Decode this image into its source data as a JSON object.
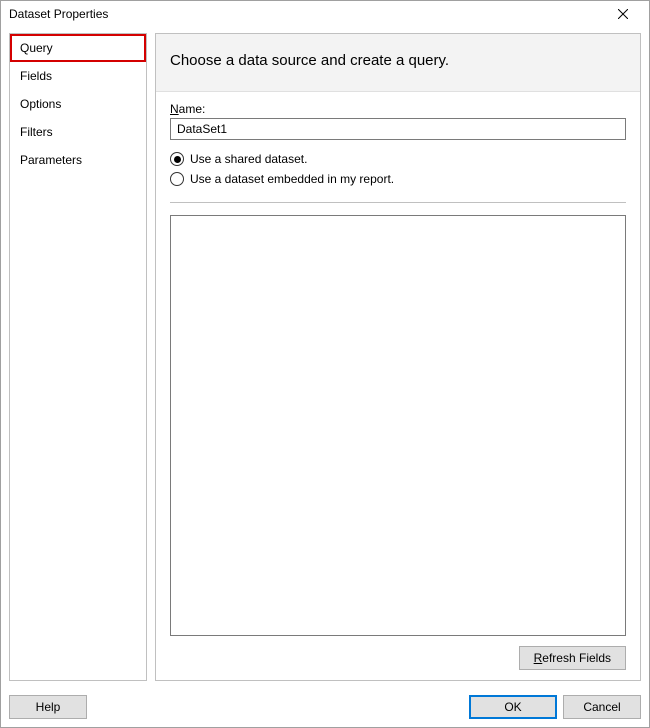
{
  "titlebar": {
    "title": "Dataset Properties"
  },
  "sidebar": {
    "items": [
      {
        "label": "Query",
        "selected": true
      },
      {
        "label": "Fields",
        "selected": false
      },
      {
        "label": "Options",
        "selected": false
      },
      {
        "label": "Filters",
        "selected": false
      },
      {
        "label": "Parameters",
        "selected": false
      }
    ]
  },
  "panel": {
    "heading": "Choose a data source and create a query.",
    "name_label_prefix": "N",
    "name_label_rest": "ame:",
    "name_value": "DataSet1",
    "radio_shared": "Use a shared dataset.",
    "radio_embedded": "Use a dataset embedded in my report.",
    "dataset_option": "shared",
    "refresh_prefix": "R",
    "refresh_rest": "efresh Fields"
  },
  "footer": {
    "help": "Help",
    "ok": "OK",
    "cancel": "Cancel"
  }
}
